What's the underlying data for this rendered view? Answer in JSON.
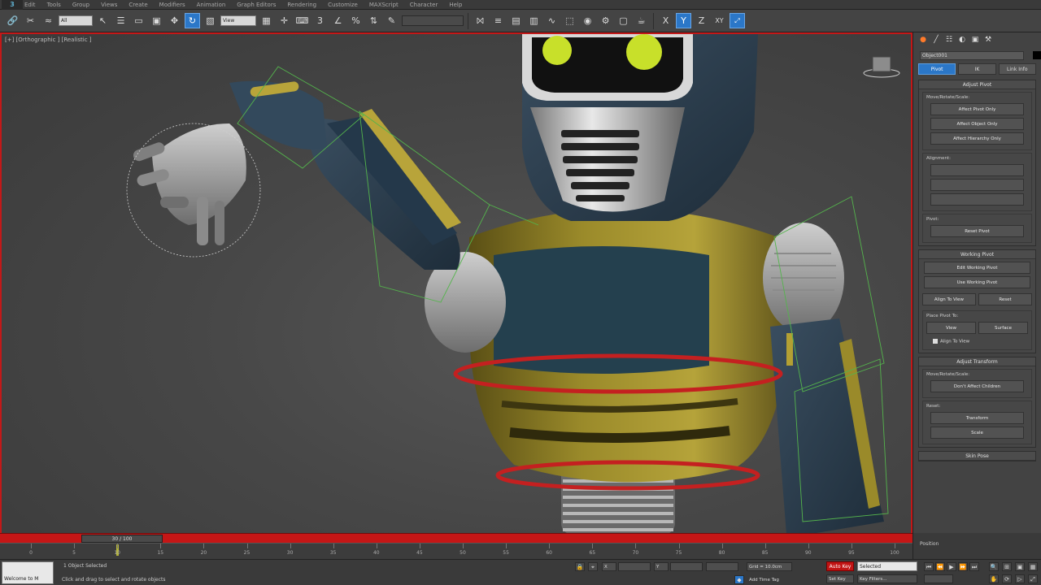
{
  "app": {
    "logo": "3"
  },
  "menu": [
    "Edit",
    "Tools",
    "Group",
    "Views",
    "Create",
    "Modifiers",
    "Animation",
    "Graph Editors",
    "Rendering",
    "Customize",
    "MAXScript",
    "Character",
    "Help"
  ],
  "toolbar": {
    "undo_icon": "undo-icon",
    "redo_icon": "redo-icon",
    "selection_filter": "All",
    "ref_coord": "View",
    "named_selection": ""
  },
  "viewport": {
    "label": "[+] [Orthographic ] [Realistic ]"
  },
  "command_panel": {
    "object_name": "Object001",
    "tabs": [
      "Pivot",
      "IK",
      "Link Info"
    ],
    "active_tab": "Pivot",
    "adjust_pivot": {
      "title": "Adjust Pivot",
      "group_label": "Move/Rotate/Scale:",
      "buttons": [
        "Affect Pivot Only",
        "Affect Object Only",
        "Affect Hierarchy Only"
      ],
      "alignment_label": "Alignment:",
      "pivot_label": "Pivot:",
      "reset_pivot": "Reset Pivot"
    },
    "working_pivot": {
      "title": "Working Pivot",
      "buttons": [
        "Edit Working Pivot",
        "Use Working Pivot"
      ],
      "row": [
        "Align To View",
        "Reset"
      ],
      "place_pivot_label": "Place Pivot To:",
      "place_row": [
        "View",
        "Surface"
      ],
      "checkbox": "Align To View"
    },
    "adjust_transform": {
      "title": "Adjust Transform",
      "group_label": "Move/Rotate/Scale:",
      "button": "Don't Affect Children",
      "reset_label": "Reset:",
      "reset_buttons": [
        "Transform",
        "Scale"
      ]
    },
    "skin_pose": {
      "title": "Skin Pose",
      "bottom": "Position"
    }
  },
  "timeline": {
    "slider_label": "30 / 100",
    "ticks": [
      0,
      5,
      10,
      15,
      20,
      25,
      30,
      35,
      40,
      45,
      50,
      55,
      60,
      65,
      70,
      75,
      80,
      85,
      90,
      95,
      100
    ]
  },
  "status": {
    "maxscript": "Welcome to M",
    "selection": "1 Object Selected",
    "prompt": "Click and drag to select and rotate objects",
    "grid": "Grid = 10.0cm",
    "add_time_tag": "Add Time Tag",
    "auto_key": "Auto Key",
    "selected": "Selected",
    "set_key": "Set Key",
    "key_filters": "Key Filters..."
  },
  "colors": {
    "accent": "#2b77c8",
    "timeslider": "#c51616",
    "robot_gold": "#9a8a2a",
    "robot_navy": "#2c3e4e",
    "ring": "#c42020",
    "eye": "#c8e02a"
  }
}
